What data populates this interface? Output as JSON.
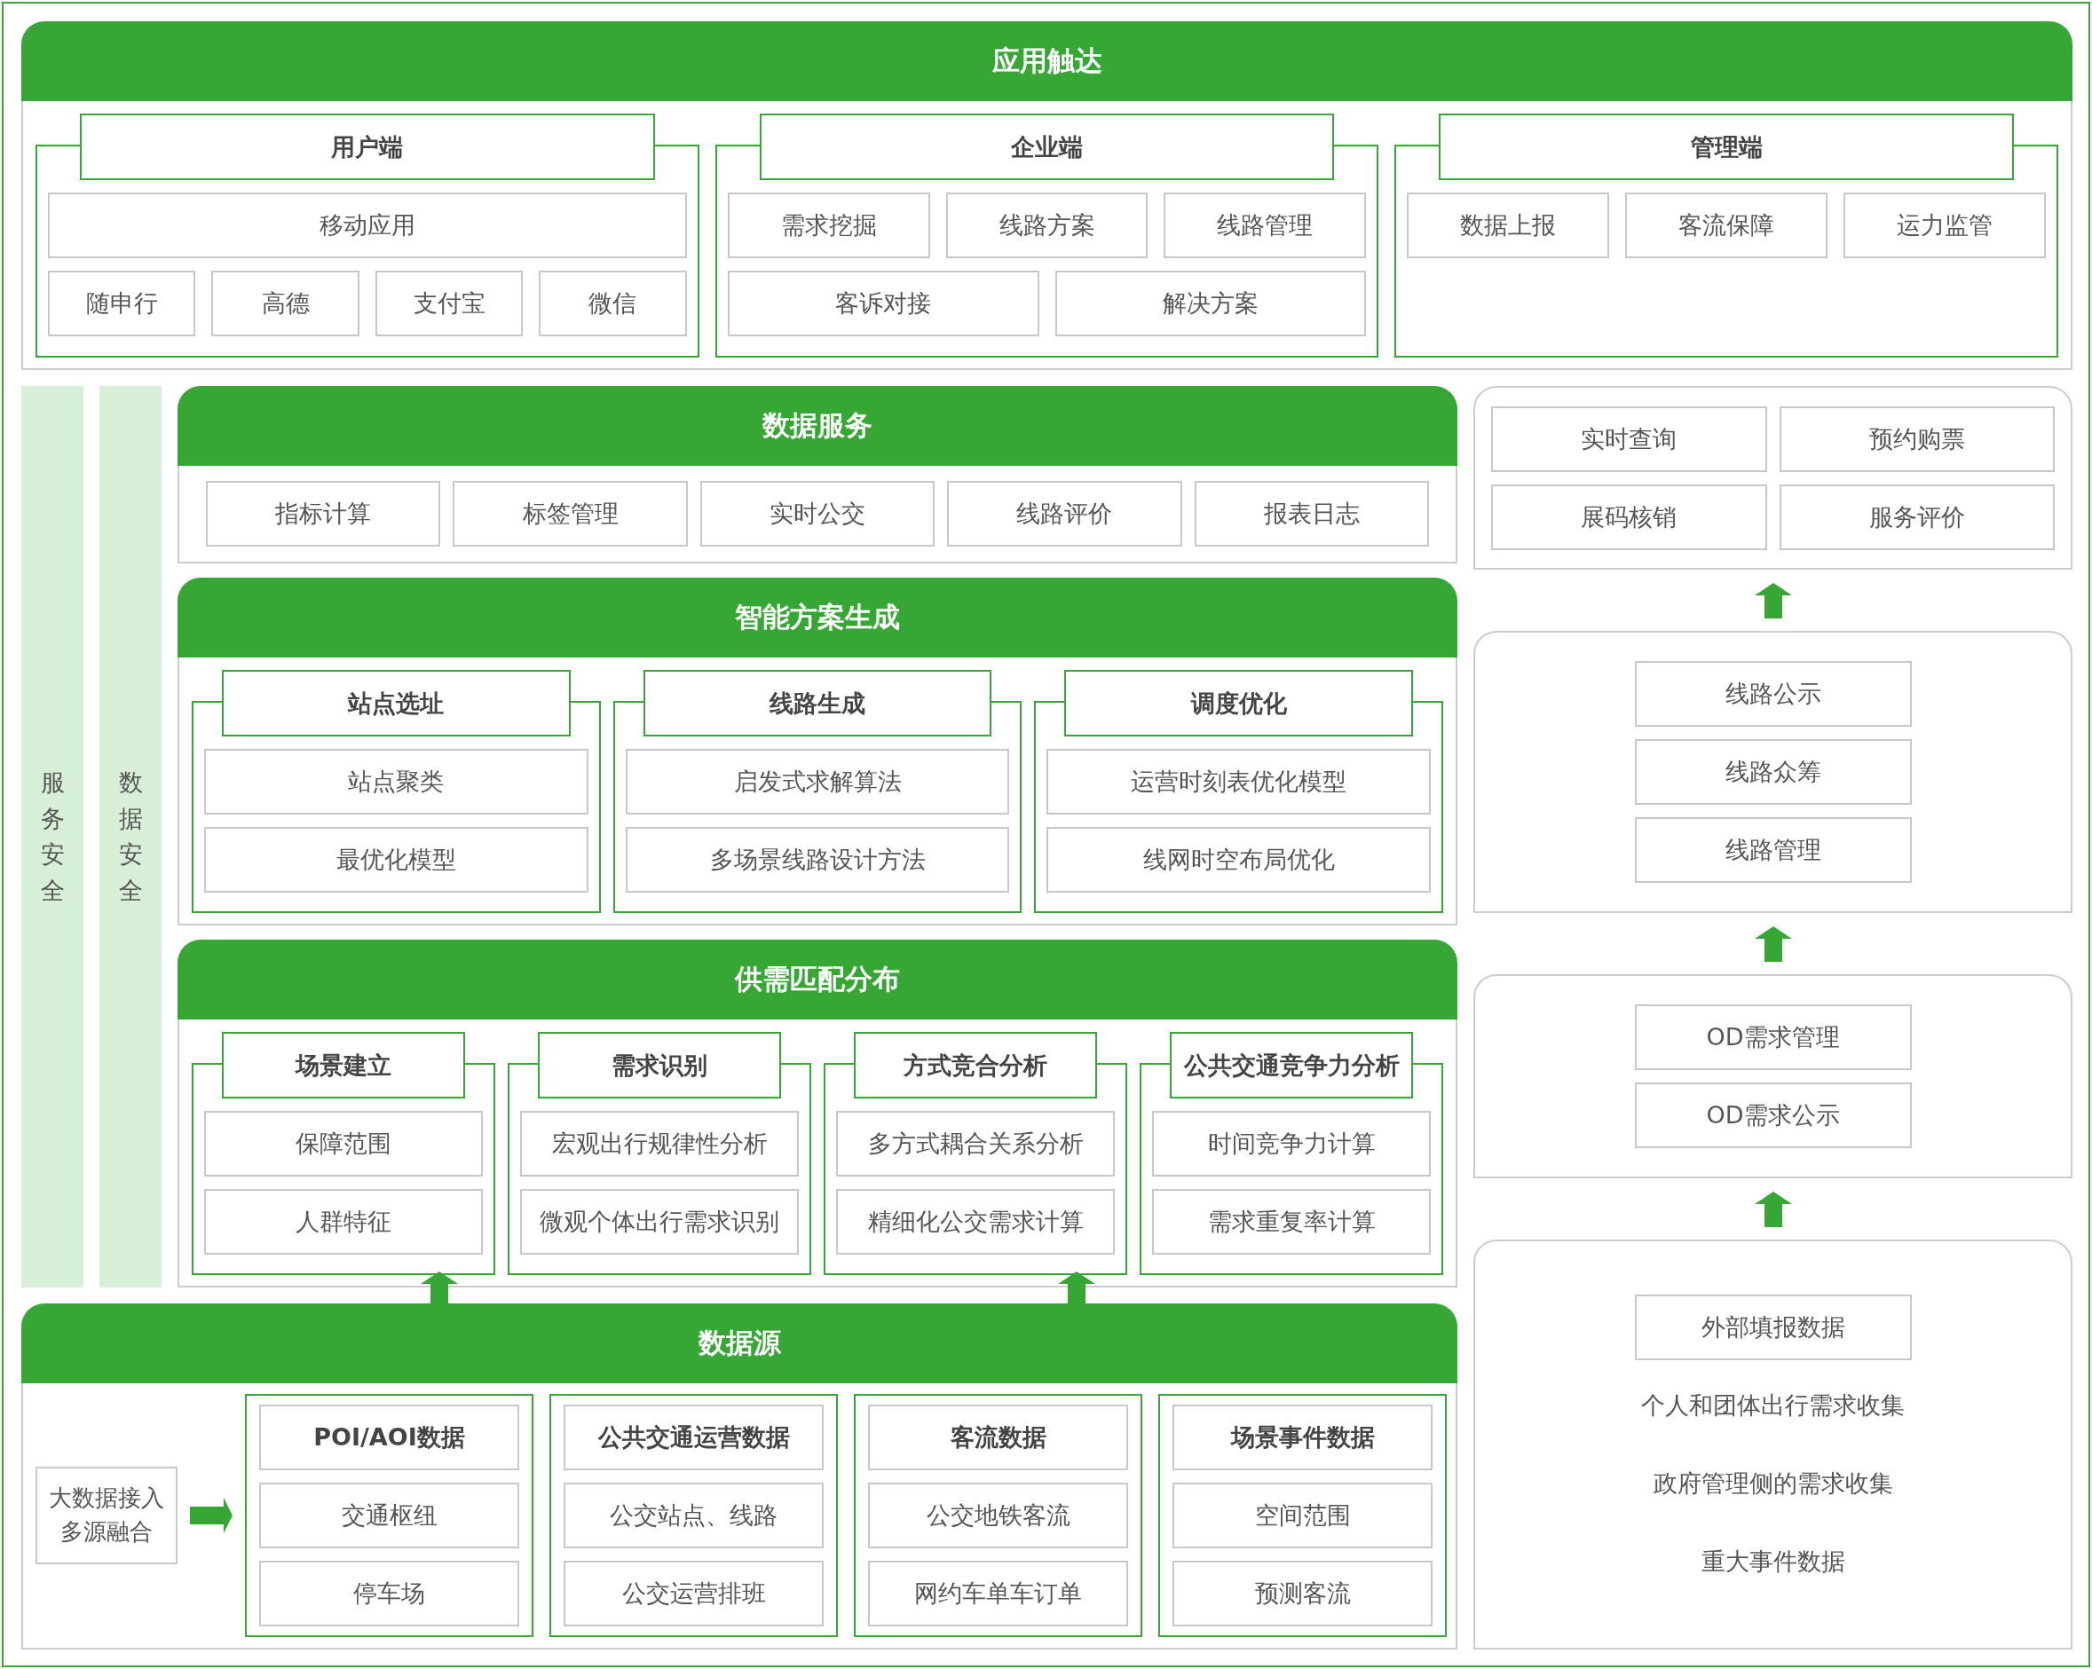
{
  "app_reach": {
    "title": "应用触达",
    "groups": [
      {
        "title": "用户端",
        "rows": [
          [
            "移动应用"
          ],
          [
            "随申行",
            "高德",
            "支付宝",
            "微信"
          ]
        ]
      },
      {
        "title": "企业端",
        "rows": [
          [
            "需求挖掘",
            "线路方案",
            "线路管理"
          ],
          [
            "客诉对接",
            "解决方案"
          ]
        ]
      },
      {
        "title": "管理端",
        "rows": [
          [
            "数据上报",
            "客流保障",
            "运力监管"
          ]
        ]
      }
    ]
  },
  "security_bars": [
    "服务安全",
    "数据安全"
  ],
  "data_service": {
    "title": "数据服务",
    "items": [
      "指标计算",
      "标签管理",
      "实时公交",
      "线路评价",
      "报表日志"
    ]
  },
  "modules": [
    {
      "title": "智能方案生成",
      "groups": [
        {
          "title": "站点选址",
          "items": [
            "站点聚类",
            "最优化模型"
          ]
        },
        {
          "title": "线路生成",
          "items": [
            "启发式求解算法",
            "多场景线路设计方法"
          ]
        },
        {
          "title": "调度优化",
          "items": [
            "运营时刻表优化模型",
            "线网时空布局优化"
          ]
        }
      ]
    },
    {
      "title": "供需匹配分布",
      "groups": [
        {
          "title": "场景建立",
          "items": [
            "保障范围",
            "人群特征"
          ]
        },
        {
          "title": "需求识别",
          "items": [
            "宏观出行规律性分析",
            "微观个体出行需求识别"
          ]
        },
        {
          "title": "方式竞合分析",
          "items": [
            "多方式耦合关系分析",
            "精细化公交需求计算"
          ]
        },
        {
          "title": "公共交通竞争力分析",
          "items": [
            "时间竞争力计算",
            "需求重复率计算"
          ]
        }
      ]
    }
  ],
  "data_source": {
    "title": "数据源",
    "input_lines": [
      "大数据接入",
      "多源融合"
    ],
    "groups": [
      {
        "title": "POI/AOI数据",
        "items": [
          "交通枢纽",
          "停车场"
        ]
      },
      {
        "title": "公共交通运营数据",
        "items": [
          "公交站点、线路",
          "公交运营排班"
        ]
      },
      {
        "title": "客流数据",
        "items": [
          "公交地铁客流",
          "网约车单车订单"
        ]
      },
      {
        "title": "场景事件数据",
        "items": [
          "空间范围",
          "预测客流"
        ]
      }
    ]
  },
  "side_panels": [
    {
      "kind": "grid",
      "items": [
        {
          "text": "实时查询",
          "boxed": true
        },
        {
          "text": "预约购票",
          "boxed": true
        },
        {
          "text": "展码核销",
          "boxed": true
        },
        {
          "text": "服务评价",
          "boxed": true
        }
      ]
    },
    {
      "kind": "list",
      "items": [
        {
          "text": "线路公示",
          "boxed": true
        },
        {
          "text": "线路众筹",
          "boxed": true
        },
        {
          "text": "线路管理",
          "boxed": true
        }
      ]
    },
    {
      "kind": "list",
      "items": [
        {
          "text": "OD需求管理",
          "boxed": true
        },
        {
          "text": "OD需求公示",
          "boxed": true
        }
      ]
    },
    {
      "kind": "list",
      "items": [
        {
          "text": "外部填报数据",
          "boxed": true
        },
        {
          "text": "个人和团体出行需求收集",
          "boxed": false
        },
        {
          "text": "政府管理侧的需求收集",
          "boxed": false
        },
        {
          "text": "重大事件数据",
          "boxed": false
        }
      ]
    }
  ]
}
